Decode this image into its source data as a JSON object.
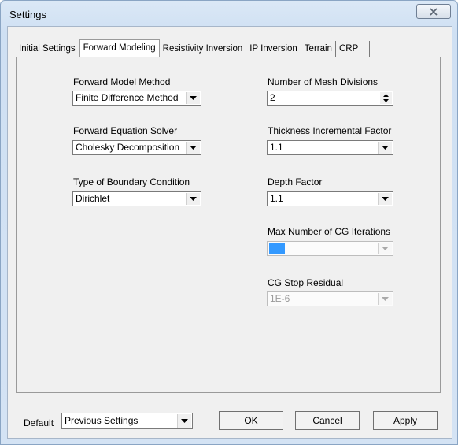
{
  "window": {
    "title": "Settings"
  },
  "tabs": [
    {
      "label": "Initial Settings"
    },
    {
      "label": "Forward Modeling"
    },
    {
      "label": "Resistivity Inversion"
    },
    {
      "label": "IP Inversion"
    },
    {
      "label": "Terrain"
    },
    {
      "label": "CRP"
    }
  ],
  "left": {
    "method_label": "Forward Model Method",
    "method_value": "Finite Difference Method",
    "solver_label": "Forward Equation Solver",
    "solver_value": "Cholesky Decomposition",
    "boundary_label": "Type of Boundary Condition",
    "boundary_value": "Dirichlet"
  },
  "right": {
    "mesh_label": "Number of Mesh Divisions",
    "mesh_value": "2",
    "thickness_label": "Thickness Incremental Factor",
    "thickness_value": "1.1",
    "depth_label": "Depth Factor",
    "depth_value": "1.1",
    "cg_iter_label": "Max Number of CG Iterations",
    "cg_iter_value": "",
    "cg_stop_label": "CG Stop Residual",
    "cg_stop_value": "1E-6"
  },
  "footer": {
    "default_label": "Default",
    "default_value": "Previous Settings",
    "ok_label": "OK",
    "cancel_label": "Cancel",
    "apply_label": "Apply"
  },
  "colors": {
    "selection": "#3399ff"
  }
}
